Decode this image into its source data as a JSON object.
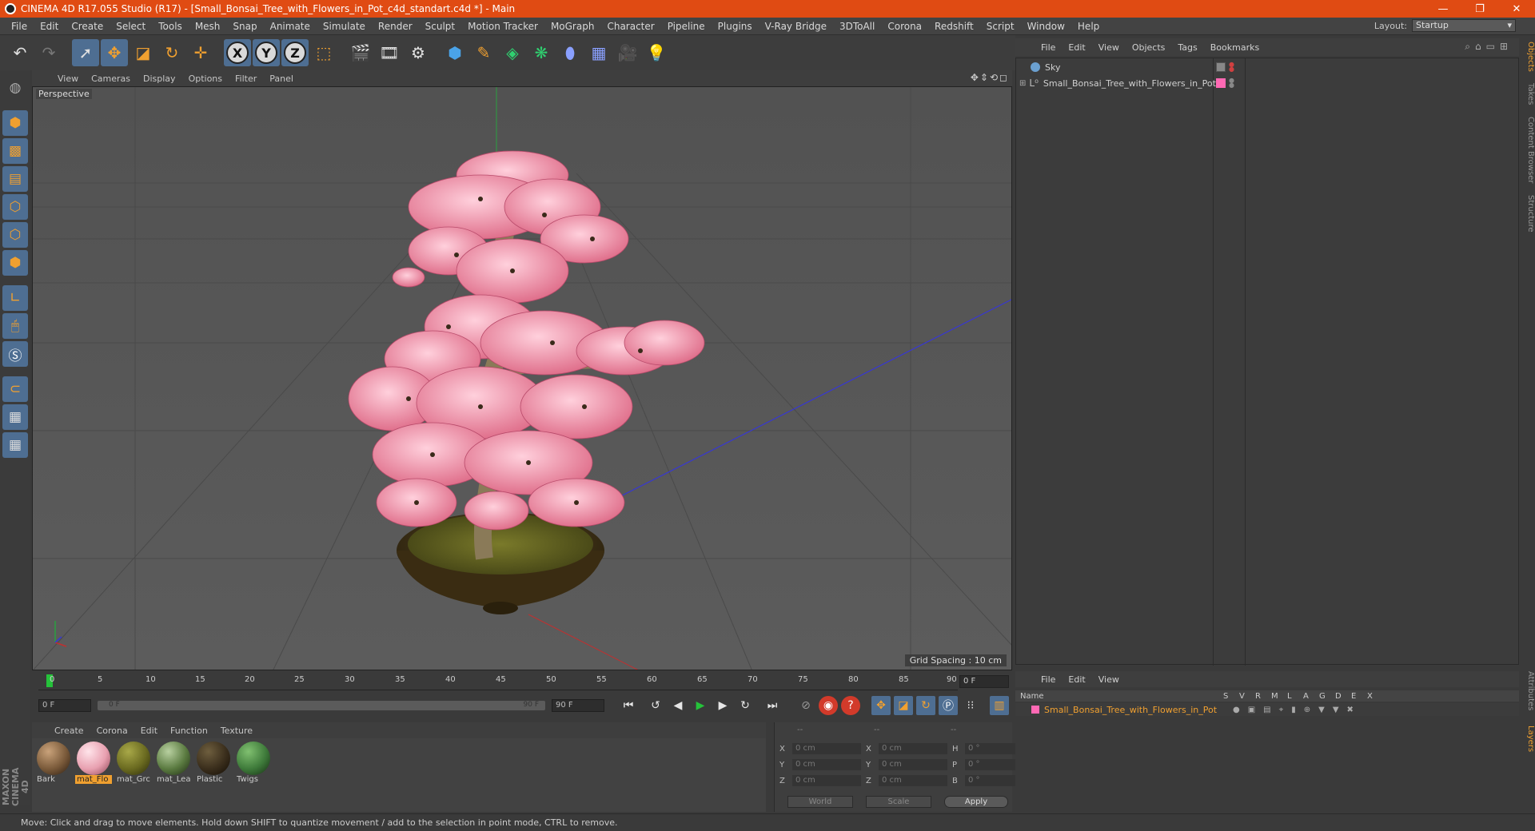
{
  "window": {
    "title": "CINEMA 4D R17.055 Studio (R17) - [Small_Bonsai_Tree_with_Flowers_in_Pot_c4d_standart.c4d *] - Main",
    "minimize": "—",
    "restore": "❐",
    "close": "✕"
  },
  "menu": [
    "File",
    "Edit",
    "Create",
    "Select",
    "Tools",
    "Mesh",
    "Snap",
    "Animate",
    "Simulate",
    "Render",
    "Sculpt",
    "Motion Tracker",
    "MoGraph",
    "Character",
    "Pipeline",
    "Plugins",
    "V-Ray Bridge",
    "3DToAll",
    "Corona",
    "Redshift",
    "Script",
    "Window",
    "Help"
  ],
  "layout": {
    "label": "Layout:",
    "value": "Startup"
  },
  "toolbar": {
    "axis_x": "X",
    "axis_y": "Y",
    "axis_z": "Z"
  },
  "viewport": {
    "menu": [
      "View",
      "Cameras",
      "Display",
      "Options",
      "Filter",
      "Panel"
    ],
    "camera": "Perspective",
    "grid_spacing": "Grid Spacing : 10 cm",
    "nav_controls": "✥⇕⟲◻"
  },
  "timeline": {
    "ticks": [
      "0",
      "5",
      "10",
      "15",
      "20",
      "25",
      "30",
      "35",
      "40",
      "45",
      "50",
      "55",
      "60",
      "65",
      "70",
      "75",
      "80",
      "85",
      "90"
    ],
    "frame_end": "0 F",
    "current_frame": "0 F",
    "range_start": "0 F",
    "range_end": "90 F",
    "max_frame": "90 F"
  },
  "materials": {
    "menu": [
      "Create",
      "Corona",
      "Edit",
      "Function",
      "Texture"
    ],
    "items": [
      {
        "label": "Bark",
        "color": "#7a5a3a"
      },
      {
        "label": "mat_Flo",
        "color": "#e8a0b0"
      },
      {
        "label": "mat_Grc",
        "color": "#6a6a20"
      },
      {
        "label": "mat_Lea",
        "color": "#5a7a40"
      },
      {
        "label": "Plastic",
        "color": "#3a2e1c"
      },
      {
        "label": "Twigs",
        "color": "#3e7a3a"
      }
    ]
  },
  "coordinates": {
    "headers": [
      "--",
      "--",
      "--"
    ],
    "rows": [
      {
        "a": "X",
        "v1": "0 cm",
        "b": "X",
        "v2": "0 cm",
        "c": "H",
        "v3": "0 °"
      },
      {
        "a": "Y",
        "v1": "0 cm",
        "b": "Y",
        "v2": "0 cm",
        "c": "P",
        "v3": "0 °"
      },
      {
        "a": "Z",
        "v1": "0 cm",
        "b": "Z",
        "v2": "0 cm",
        "c": "B",
        "v3": "0 °"
      }
    ],
    "world": "World",
    "scale": "Scale",
    "apply": "Apply"
  },
  "objects": {
    "menu": [
      "File",
      "Edit",
      "View",
      "Objects",
      "Tags",
      "Bookmarks"
    ],
    "items": [
      "Sky",
      "Small_Bonsai_Tree_with_Flowers_in_Pot"
    ],
    "tag_color": "#ff69b4"
  },
  "layers": {
    "menu": [
      "File",
      "Edit",
      "View"
    ],
    "columns": [
      "Name",
      "S",
      "V",
      "R",
      "M",
      "L",
      "A",
      "G",
      "D",
      "E",
      "X"
    ],
    "row_name": "Small_Bonsai_Tree_with_Flowers_in_Pot"
  },
  "sidetabs": [
    "Objects",
    "Takes",
    "Content Browser",
    "Structure",
    "Attributes",
    "Layers"
  ],
  "brand": "MAXON CINEMA 4D",
  "status": "Move: Click and drag to move elements. Hold down SHIFT to quantize movement / add to the selection in point mode, CTRL to remove."
}
